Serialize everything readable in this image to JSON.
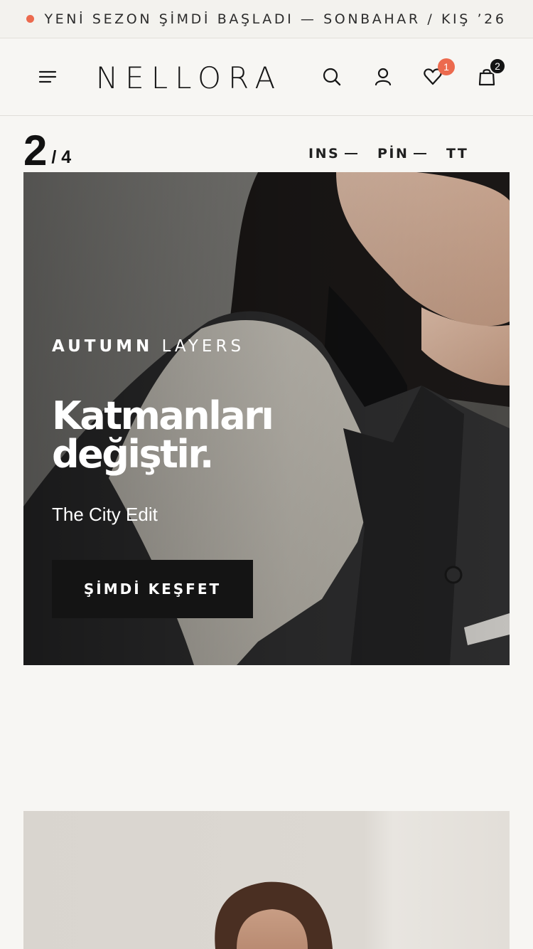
{
  "announcement": {
    "text": "YENİ SEZON ŞİMDİ BAŞLADI — SONBAHAR / KIŞ ’26",
    "dot_color": "#ec6a4e"
  },
  "header": {
    "logo": "NELLORA",
    "icons": [
      "menu-icon",
      "search-icon",
      "user-icon",
      "heart-icon",
      "shopping-bag-icon"
    ],
    "wishlist_count": "1",
    "cart_count": "2"
  },
  "slider": {
    "current": "2",
    "total": "/ 4",
    "social": [
      "INS",
      "PİN",
      "TT"
    ]
  },
  "hero": {
    "eyebrow_bold": "AUTUMN",
    "eyebrow_light": "LAYERS",
    "headline_line1": "Katmanları",
    "headline_line2": "değiştir.",
    "subline": "The City Edit",
    "cta": "ŞİMDİ KEŞFET"
  },
  "colors": {
    "accent": "#ec6a4e",
    "dark": "#141414",
    "background": "#f7f6f3"
  }
}
